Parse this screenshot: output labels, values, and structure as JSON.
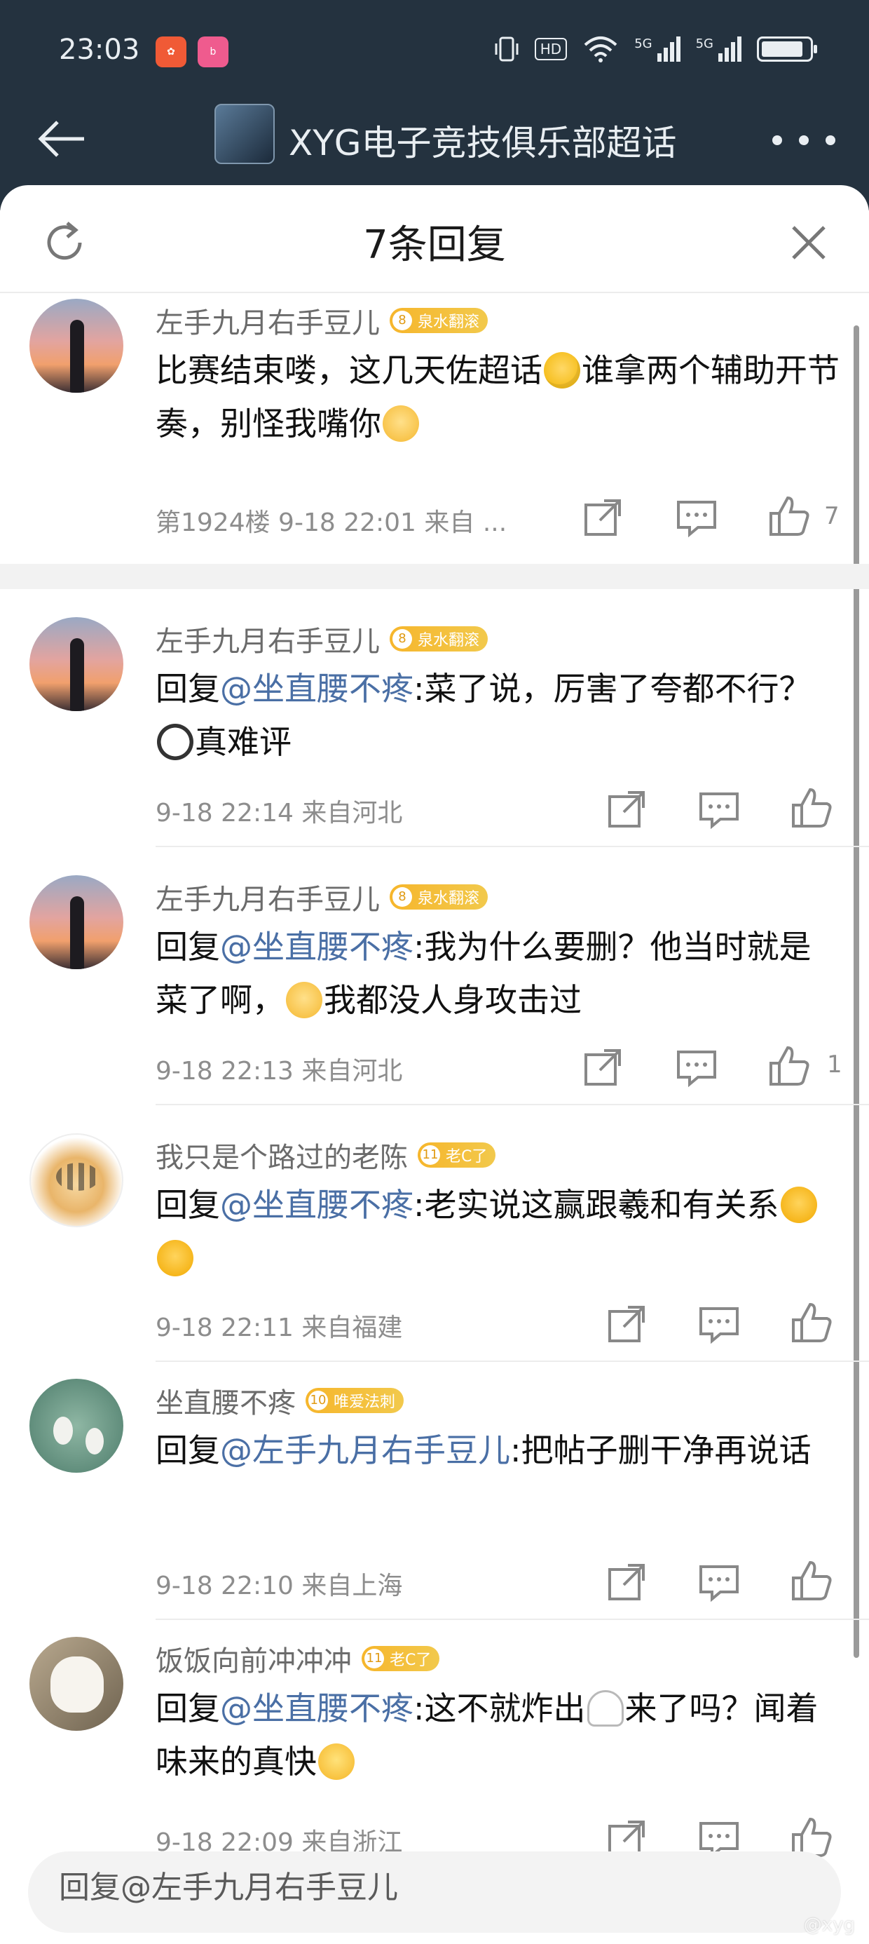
{
  "status_bar": {
    "time": "23:03",
    "icons": [
      "xiaohongshu-icon",
      "bilibili-icon",
      "vibrate-icon",
      "hd-icon",
      "wifi-icon",
      "5g-signal-icon",
      "5g-signal-icon",
      "battery-icon"
    ],
    "hd": "HD",
    "net1": "5G",
    "net2": "5G"
  },
  "nav": {
    "title": "XYG电子竞技俱乐部超话",
    "back_icon": "back-arrow-icon",
    "more_icon": "more-dots-icon"
  },
  "panel": {
    "title": "7条回复",
    "refresh_icon": "refresh-icon",
    "close_icon": "close-icon"
  },
  "root_comment": {
    "user": "左手九月右手豆儿",
    "badge_level": "8",
    "badge_text": "泉水翻滚",
    "text_a": "比赛结束喽，这几天佐超话",
    "text_b": "谁拿两个辅助开节奏，别怪我嘴你",
    "meta": "第1924楼 9-18 22:01 来自 ...",
    "likes": "7"
  },
  "replies": [
    {
      "user": "左手九月右手豆儿",
      "badge_level": "8",
      "badge_text": "泉水翻滚",
      "prefix": "回复",
      "mention": "@坐直腰不疼",
      "text": ":菜了说，厉害了夸都不行？",
      "text_after": "真难评",
      "meta": "9-18 22:14  来自河北",
      "likes": ""
    },
    {
      "user": "左手九月右手豆儿",
      "badge_level": "8",
      "badge_text": "泉水翻滚",
      "prefix": "回复",
      "mention": "@坐直腰不疼",
      "text": ":我为什么要删？他当时就是菜了啊，",
      "text_after": "我都没人身攻击过",
      "meta": "9-18 22:13  来自河北",
      "likes": "1"
    },
    {
      "user": "我只是个路过的老陈",
      "badge_level": "11",
      "badge_text": "老C了",
      "prefix": "回复",
      "mention": "@坐直腰不疼",
      "text": ":老实说这赢跟羲和有关系",
      "text_after": "",
      "meta": "9-18 22:11  来自福建",
      "likes": ""
    },
    {
      "user": "坐直腰不疼",
      "badge_level": "10",
      "badge_text": "唯爱法刺",
      "prefix": "回复",
      "mention": "@左手九月右手豆儿",
      "text": ":把帖子删干净再说话",
      "text_after": "",
      "meta": "9-18 22:10  来自上海",
      "likes": ""
    },
    {
      "user": "饭饭向前冲冲冲",
      "badge_level": "11",
      "badge_text": "老C了",
      "prefix": "回复",
      "mention": "@坐直腰不疼",
      "text": ":这不就炸出",
      "text_after": "来了吗？闻着味来的真快",
      "meta": "9-18 22:09  来自浙江",
      "likes": ""
    }
  ],
  "actions": {
    "share_icon": "share-icon",
    "comment_icon": "comment-icon",
    "like_icon": "thumbs-up-icon"
  },
  "reply_bar": {
    "placeholder": "回复@左手九月右手豆儿"
  },
  "watermark": "@xyg",
  "colors": {
    "header_bg": "#24323f",
    "mention": "#4a6fa5",
    "badge": "#f6b62c",
    "meta": "#8d8d8d"
  }
}
